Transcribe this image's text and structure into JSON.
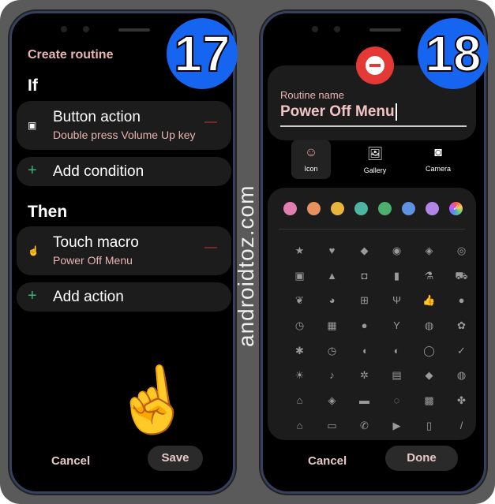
{
  "steps": {
    "left": "17",
    "right": "18"
  },
  "watermark": "androidtoz.com",
  "screen17": {
    "title": "Create routine",
    "if_label": "If",
    "condition": {
      "icon": "button-action-icon",
      "title": "Button action",
      "subtitle": "Double press Volume Up key"
    },
    "add_condition": "Add condition",
    "then_label": "Then",
    "action": {
      "icon": "touch-macro-icon",
      "title": "Touch macro",
      "subtitle": "Power Off Menu"
    },
    "add_action": "Add action",
    "cancel": "Cancel",
    "save": "Save"
  },
  "screen18": {
    "routine_name_label": "Routine name",
    "routine_name_value": "Power Off Menu",
    "sources": [
      {
        "label": "Icon",
        "glyph": "☺",
        "selected": true
      },
      {
        "label": "Gallery",
        "glyph": "🖼"
      },
      {
        "label": "Camera",
        "glyph": "◙"
      }
    ],
    "colors": [
      "#e07fae",
      "#e8915f",
      "#e8b43c",
      "#4fb3a2",
      "#4caf6e",
      "#5d93e0",
      "#b085e8",
      "#gradient"
    ],
    "selected_color_index": 7,
    "icons": [
      "★",
      "♥",
      "◆",
      "◉",
      "◈",
      "◎",
      "▣",
      "▲",
      "◘",
      "▮",
      "⚗",
      "⛟",
      "❦",
      "◕",
      "⊞",
      "Ψ",
      "👍",
      "●",
      "◷",
      "▦",
      "●",
      "Y",
      "◍",
      "✿",
      "✱",
      "◷",
      "◖",
      "◐",
      "◯",
      "✓",
      "☀",
      "♪",
      "✲",
      "▤",
      "◆",
      "◍",
      "⌂",
      "◈",
      "▬",
      "◌",
      "▩",
      "✤",
      "⌂",
      "▭",
      "✆",
      "▶",
      "▯",
      "/"
    ],
    "cancel": "Cancel",
    "done": "Done"
  }
}
